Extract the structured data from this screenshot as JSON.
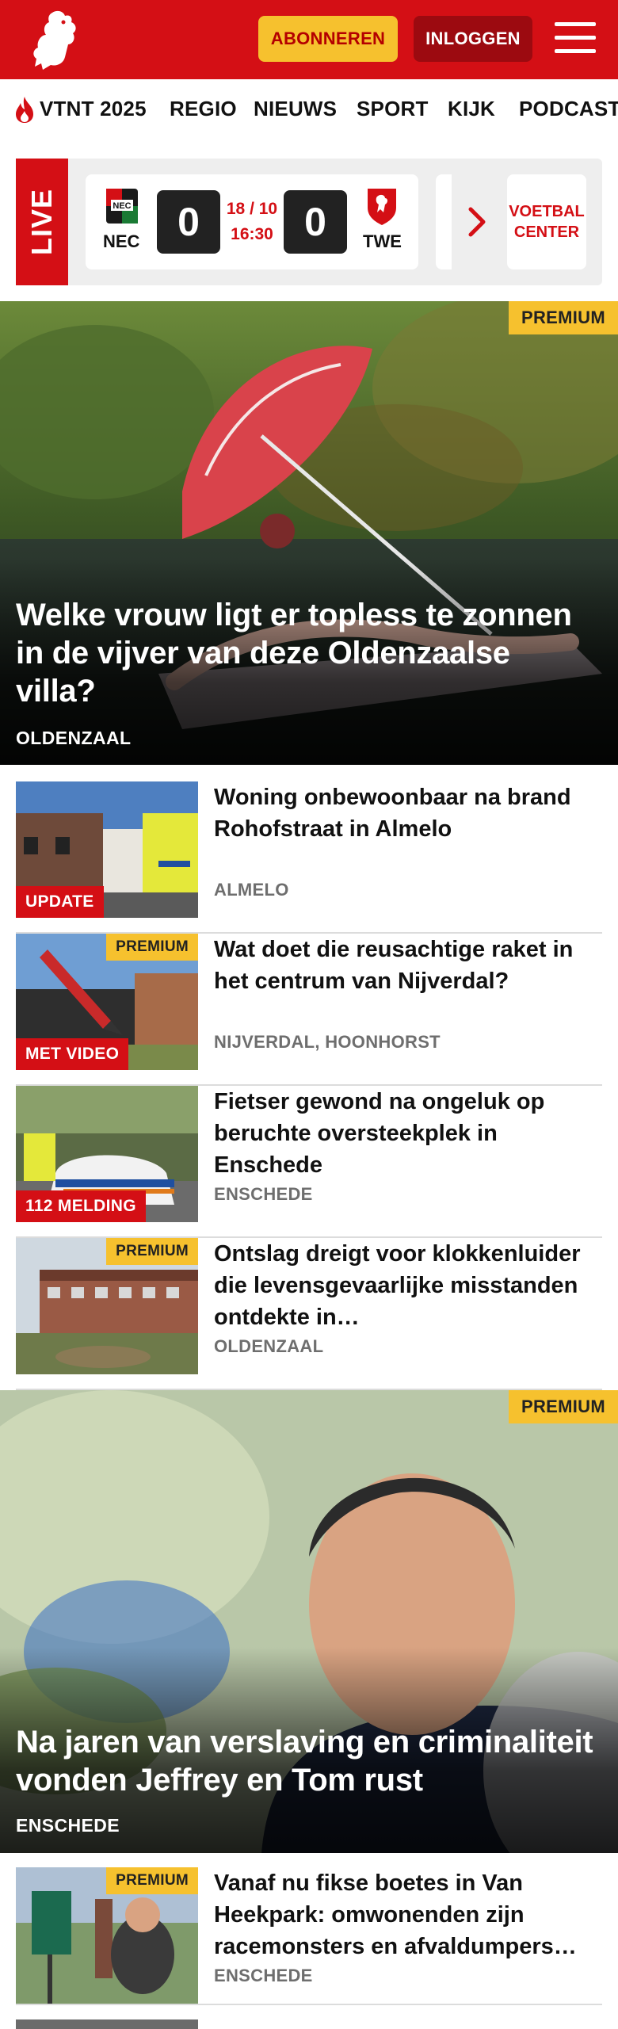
{
  "header": {
    "subscribe_label": "ABONNEREN",
    "login_label": "INLOGGEN",
    "brand_color": "#d40f15",
    "subscribe_color": "#f6c12e"
  },
  "nav": {
    "items": [
      "VTNT 2025",
      "REGIO",
      "NIEUWS",
      "SPORT",
      "KIJK",
      "PODCAST"
    ]
  },
  "live": {
    "tag": "LIVE",
    "match": {
      "home": "NEC",
      "away": "TWE",
      "home_score": "0",
      "away_score": "0",
      "date": "18 / 10",
      "time": "16:30"
    },
    "center_label": "VOETBAL CENTER"
  },
  "hero1": {
    "premium": "PREMIUM",
    "title": "Welke vrouw ligt er topless te zonnen in de vijver van deze Oldenzaalse villa?",
    "location": "OLDENZAAL"
  },
  "articles": [
    {
      "title": "Woning onbewoonbaar na brand Rohofstraat in Almelo",
      "location": "ALMELO",
      "label": "UPDATE",
      "premium": ""
    },
    {
      "title": "Wat doet die reusachtige raket in het centrum van Nijverdal?",
      "location": "NIJVERDAL, HOONHORST",
      "label": "MET VIDEO",
      "premium": "PREMIUM"
    },
    {
      "title": "Fietser gewond na ongeluk op beruchte oversteekplek in Enschede",
      "location": "ENSCHEDE",
      "label": "112 MELDING",
      "premium": ""
    },
    {
      "title": "Ontslag dreigt voor klokkenlui­der die levensgevaarlijke misstanden ontdekte in…",
      "location": "OLDENZAAL",
      "label": "",
      "premium": "PREMIUM"
    }
  ],
  "hero2": {
    "premium": "PREMIUM",
    "title": "Na jaren van verslaving en criminali­teit vonden Jeffrey en Tom rust",
    "location": "ENSCHEDE"
  },
  "articles2": [
    {
      "title": "Vanaf nu fikse boetes in Van Heekpark: omwonenden zijn racemonsters en afvaldumpers…",
      "location": "ENSCHEDE",
      "premium": "PREMIUM"
    }
  ]
}
